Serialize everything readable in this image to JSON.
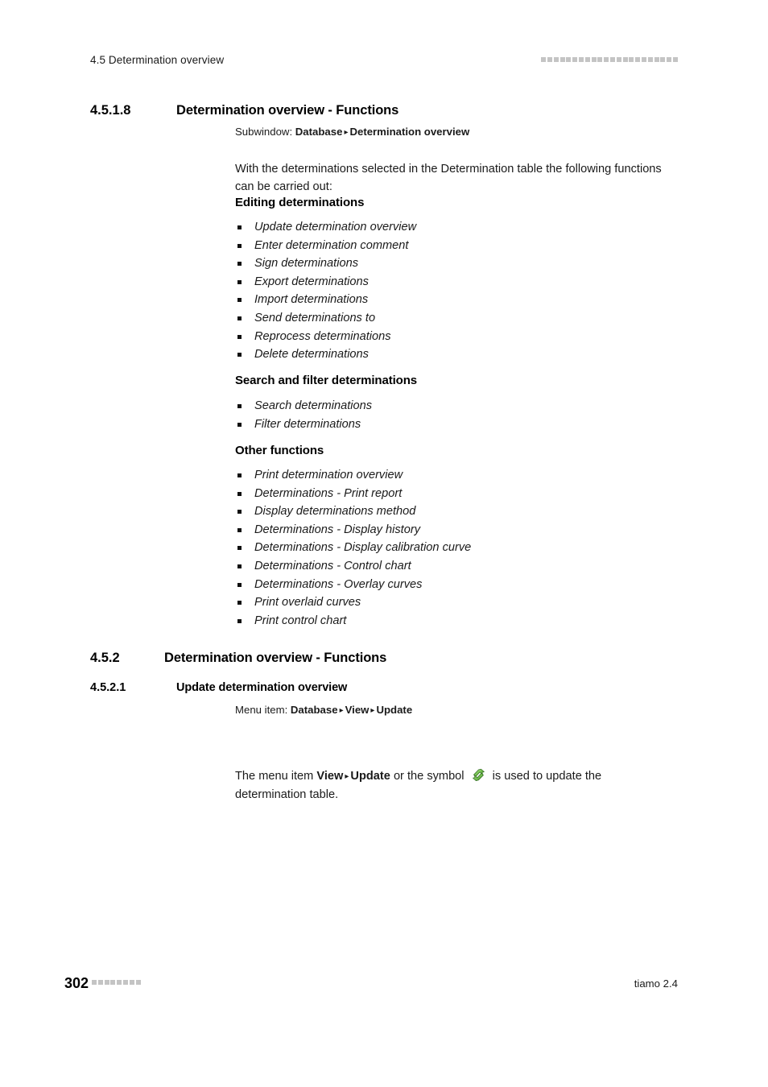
{
  "header": {
    "title": "4.5 Determination overview",
    "decoration_mark_count": 22,
    "decoration_color": "#c4c4c4"
  },
  "sections": {
    "s4518": {
      "number": "4.5.1.8",
      "title": "Determination overview - Functions",
      "meta": {
        "lead": "Subwindow:",
        "path": [
          "Database",
          "Determination overview"
        ],
        "separator": "▸"
      },
      "intro_paragraph": "With the determinations selected in the Determination table the following functions can be carried out:",
      "groups": [
        {
          "heading": "Editing determinations",
          "items": [
            "Update determination overview",
            "Enter determination comment",
            "Sign determinations",
            "Export determinations",
            "Import determinations",
            "Send determinations to",
            "Reprocess determinations",
            "Delete determinations"
          ]
        },
        {
          "heading": "Search and filter determinations",
          "items": [
            "Search determinations",
            "Filter determinations"
          ]
        },
        {
          "heading": "Other functions",
          "items": [
            "Print determination overview",
            "Determinations - Print report",
            "Display determinations method",
            "Determinations - Display history",
            "Determinations - Display calibration curve",
            "Determinations - Control chart",
            "Determinations - Overlay curves",
            "Print overlaid curves",
            "Print control chart"
          ]
        }
      ]
    },
    "s452": {
      "number": "4.5.2",
      "title": "Determination overview - Functions"
    },
    "s4521": {
      "number": "4.5.2.1",
      "title": "Update determination overview",
      "meta": {
        "lead": "Menu item:",
        "path": [
          "Database",
          "View",
          "Update"
        ],
        "separator": "▸"
      },
      "paragraph": {
        "part1": "The menu item ",
        "bold1": "View",
        "sep": "▸",
        "bold2": "Update",
        "part2": " or the symbol ",
        "symbol_name": "refresh-update-icon",
        "symbol_color": "#6cbf4a",
        "part3": " is used to update the determination table."
      }
    }
  },
  "footer": {
    "page_number": "302",
    "decoration_mark_count": 8,
    "product": "tiamo 2.4"
  }
}
